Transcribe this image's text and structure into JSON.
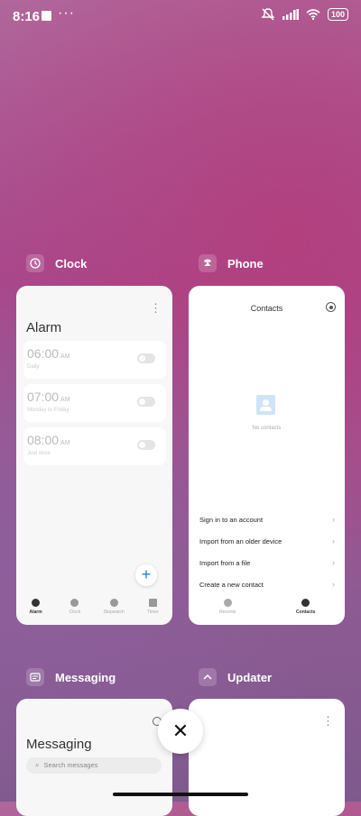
{
  "status_bar": {
    "time": "8:16",
    "more": "···",
    "battery": "100"
  },
  "apps": {
    "clock": {
      "label": "Clock",
      "screen_title": "Alarm",
      "alarms": [
        {
          "time": "06:00",
          "ampm": "AM",
          "sub": "Daily"
        },
        {
          "time": "07:00",
          "ampm": "AM",
          "sub": "Monday to Friday"
        },
        {
          "time": "08:00",
          "ampm": "AM",
          "sub": "Just once"
        }
      ],
      "fab": "+",
      "nav": [
        "Alarm",
        "Clock",
        "Stopwatch",
        "Timer"
      ]
    },
    "phone": {
      "label": "Phone",
      "screen_title": "Contacts",
      "empty_text": "No contacts",
      "menu": [
        "Sign in to an account",
        "Import from an older device",
        "Import from a file",
        "Create a new contact"
      ],
      "nav": [
        "Recents",
        "Contacts"
      ]
    },
    "messaging": {
      "label": "Messaging",
      "screen_title": "Messaging",
      "search_placeholder": "Search messages"
    },
    "updater": {
      "label": "Updater"
    }
  },
  "controls": {
    "close": "✕",
    "chevron": "›",
    "kebab": "⋮"
  },
  "colors": {
    "accent": "#2a7fd4",
    "empty_icon": "#cfe4f8"
  }
}
